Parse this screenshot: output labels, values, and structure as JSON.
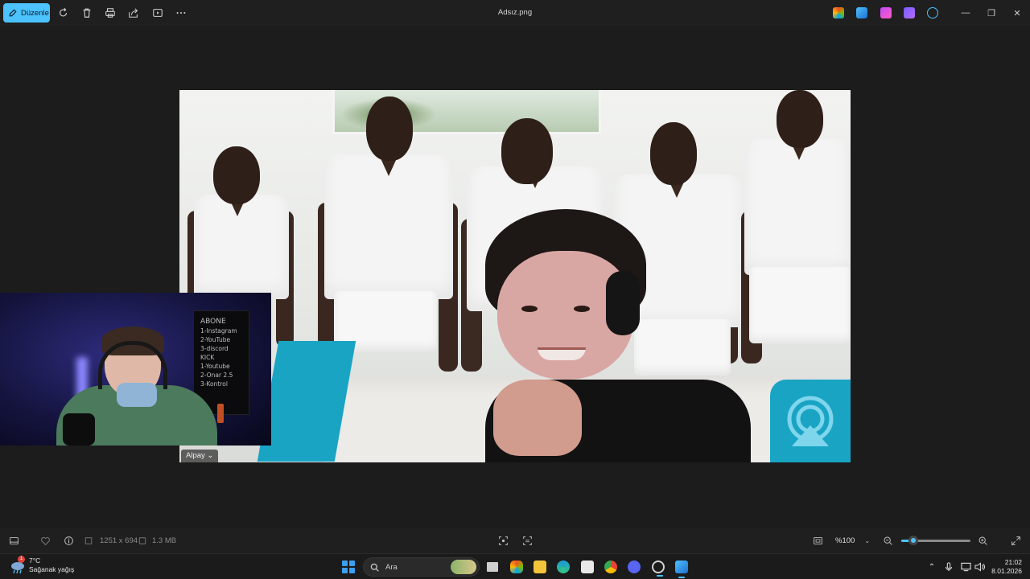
{
  "toolbar": {
    "edit_label": "Düzenle",
    "title": "Adsız.png",
    "icons": [
      "rotate-icon",
      "delete-icon",
      "print-icon",
      "share-icon",
      "slideshow-icon",
      "more-icon"
    ]
  },
  "window_controls": {
    "minimize": "—",
    "restore": "❐",
    "close": "✕"
  },
  "image": {
    "name_tag": "Alpay ⌄",
    "webcam_board": {
      "title": "ABONE",
      "lines": [
        "1-Instagram",
        "2-YouTube",
        "3-discord",
        "KICK",
        "1-Youtube",
        "2-Onar 2.5",
        "3-Kontrol"
      ]
    }
  },
  "statusbar": {
    "dimensions": "1251 x 694",
    "file_size": "1.3 MB",
    "zoom_level": "%100",
    "zoom_fraction": 0.17
  },
  "taskbar": {
    "weather_temp": "7°C",
    "weather_desc": "Sağanak yağış",
    "weather_badge": "1",
    "search_placeholder": "Ara",
    "time": "21:02",
    "date": "8.01.2026"
  },
  "colors": {
    "accent": "#4cc2ff",
    "teal": "#1aa4c4"
  }
}
